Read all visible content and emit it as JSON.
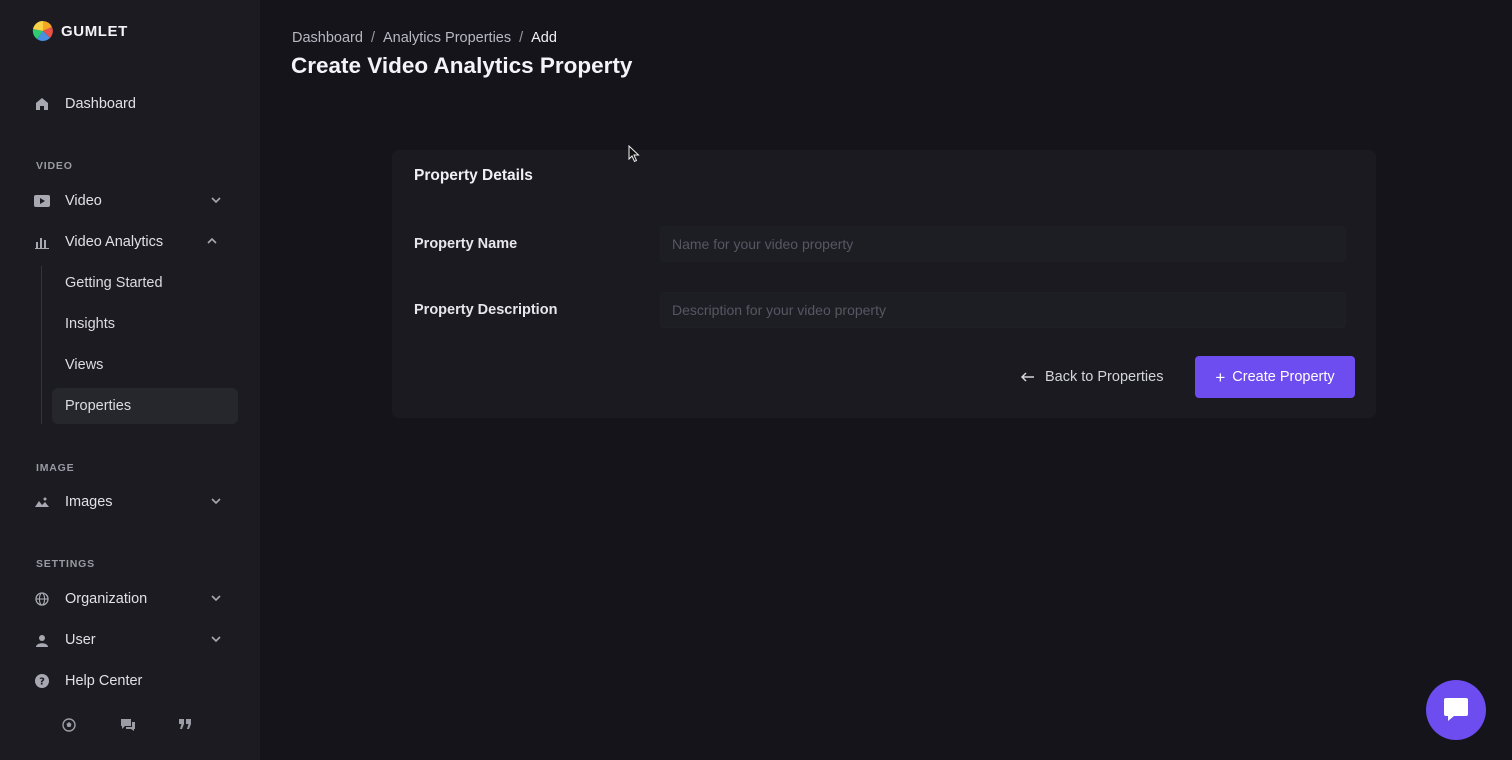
{
  "brand": {
    "name": "GUMLET"
  },
  "sidebar": {
    "dashboard": "Dashboard",
    "sections": {
      "video": "VIDEO",
      "image": "IMAGE",
      "settings": "SETTINGS"
    },
    "items": {
      "video": "Video",
      "video_analytics": "Video Analytics",
      "images": "Images",
      "organization": "Organization",
      "user": "User",
      "help_center": "Help Center"
    },
    "sub_items": [
      "Getting Started",
      "Insights",
      "Views",
      "Properties"
    ],
    "active_sub_item": "Properties"
  },
  "breadcrumb": {
    "items": [
      "Dashboard",
      "Analytics Properties",
      "Add"
    ],
    "separator": "/"
  },
  "page_title": "Create Video Analytics Property",
  "card": {
    "title": "Property Details",
    "fields": {
      "name": {
        "label": "Property Name",
        "value": "",
        "placeholder": "Name for your video property"
      },
      "description": {
        "label": "Property Description",
        "value": "",
        "placeholder": "Description for your video property"
      }
    },
    "back_label": "Back to Properties",
    "create_label": "Create Property"
  },
  "colors": {
    "accent": "#6d4cf0",
    "background": "#15141b",
    "sidebar": "#1b1b21",
    "card": "#1a1a20"
  }
}
